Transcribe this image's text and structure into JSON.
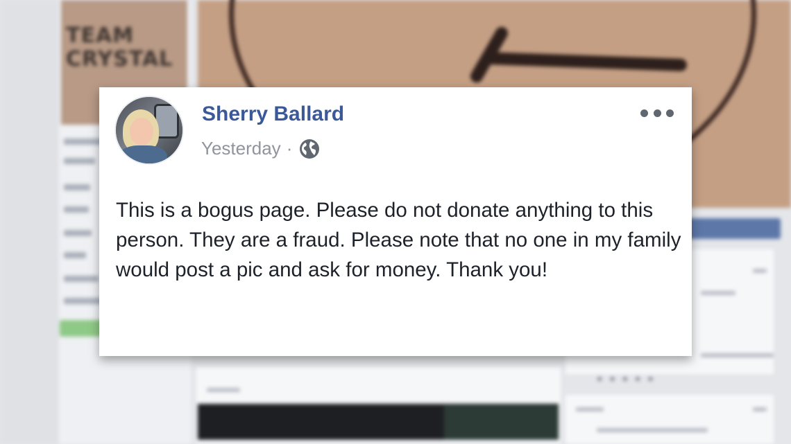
{
  "post": {
    "author": "Sherry Ballard",
    "timestamp": "Yesterday",
    "separator": "·",
    "audience_icon": "globe-icon",
    "more_icon": "more-options-icon",
    "text": "This is a bogus page. Please do not donate anything to this person. They are a fraud. Please note that no one in my family would post a pic and ask for money. Thank you!"
  },
  "background": {
    "profile_picture_text": "TEAM CRYSTAL"
  },
  "colors": {
    "author_link": "#3b5998",
    "meta_text": "#90949c",
    "body_text": "#1d2129"
  }
}
